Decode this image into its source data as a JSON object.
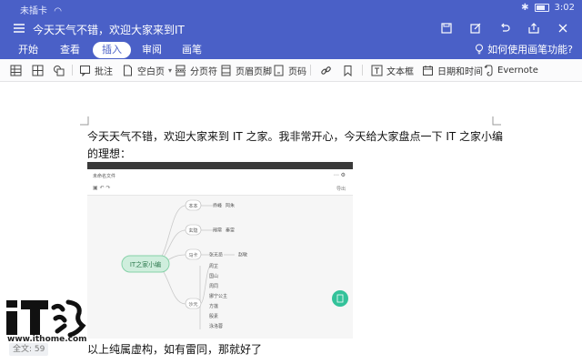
{
  "status_bar": {
    "carrier": "未插卡",
    "time": "3:02"
  },
  "titlebar": {
    "document_title": "今天天气不错，欢迎大家来到IT"
  },
  "ribbon": {
    "tabs": [
      "开始",
      "查看",
      "插入",
      "审阅",
      "画笔"
    ],
    "active_tab": "插入",
    "help_label": "如何使用画笔功能?"
  },
  "toolbar": {
    "comment": "批注",
    "blank_page": "空白页",
    "page_break": "分页符",
    "header_footer": "页眉页脚",
    "page_number": "页码",
    "textbox": "文本框",
    "datetime": "日期和时间",
    "evernote": "Evernote"
  },
  "document": {
    "paragraph1": "今天天气不错，欢迎大家来到 IT 之家。我非常开心，今天给大家盘点一下 IT 之家小编的理想：",
    "paragraph2": "以上纯属虚构，如有雷同，那就好了"
  },
  "mindmap": {
    "title_bar": "未命名文件",
    "toolbar_right": "导出",
    "root": "IT之家小编",
    "branches": [
      {
        "label": "本本",
        "children": [
          "乔峰",
          "阿朱"
        ]
      },
      {
        "label": "玄隐",
        "children": [
          "邢常",
          "秦雷"
        ]
      },
      {
        "label": "马卡",
        "children": [
          "张无忌"
        ],
        "grandchild": "赵敏"
      },
      {
        "label": "沙元",
        "children": [
          "周芷",
          "国山",
          "周同",
          "娜宁公主",
          "方莲",
          "殷素",
          "泳洛蓉"
        ]
      }
    ]
  },
  "watermark": {
    "url": "www.ithome.com"
  },
  "footer": {
    "word_count": "全文: 59"
  }
}
